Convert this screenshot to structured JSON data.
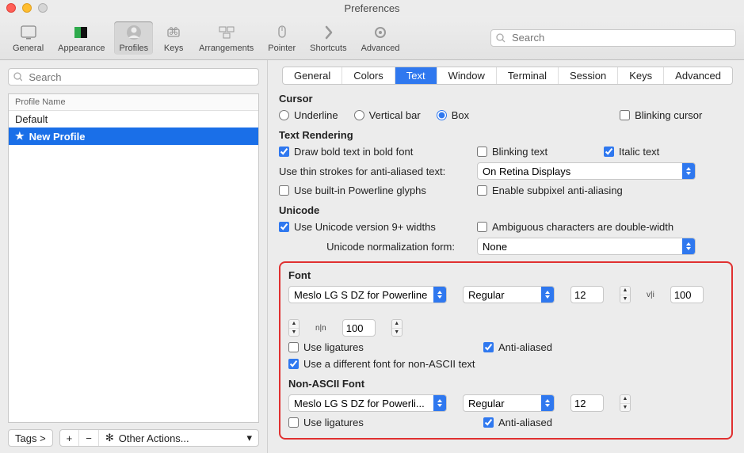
{
  "title": "Preferences",
  "toolbar": {
    "items": [
      "General",
      "Appearance",
      "Profiles",
      "Keys",
      "Arrangements",
      "Pointer",
      "Shortcuts",
      "Advanced"
    ],
    "selected": 2,
    "searchPlaceholder": "Search"
  },
  "left": {
    "searchPlaceholder": "Search",
    "header": "Profile Name",
    "profiles": [
      "Default",
      "New Profile"
    ],
    "selected": 1,
    "tagsLabel": "Tags >",
    "plus": "+",
    "minus": "−",
    "otherActions": "Other Actions..."
  },
  "tabs": {
    "items": [
      "General",
      "Colors",
      "Text",
      "Window",
      "Terminal",
      "Session",
      "Keys",
      "Advanced"
    ],
    "selected": 2
  },
  "cursor": {
    "heading": "Cursor",
    "underline": "Underline",
    "vertical": "Vertical bar",
    "box": "Box",
    "blinking": "Blinking cursor"
  },
  "textRendering": {
    "heading": "Text Rendering",
    "bold": "Draw bold text in bold font",
    "blink": "Blinking text",
    "italic": "Italic text",
    "thinLabel": "Use thin strokes for anti-aliased text:",
    "thinValue": "On Retina Displays",
    "powerline": "Use built-in Powerline glyphs",
    "subpixel": "Enable subpixel anti-aliasing"
  },
  "unicode": {
    "heading": "Unicode",
    "v9": "Use Unicode version 9+ widths",
    "ambig": "Ambiguous characters are double-width",
    "normLabel": "Unicode normalization form:",
    "normValue": "None"
  },
  "font": {
    "heading": "Font",
    "family": "Meslo LG S DZ for Powerline",
    "style": "Regular",
    "size": "12",
    "vhLabel": "v|i",
    "vh": "100",
    "hhLabel": "n|n",
    "hh": "100",
    "ligatures": "Use ligatures",
    "aa": "Anti-aliased",
    "nonascii": "Use a different font for non-ASCII text"
  },
  "nafont": {
    "heading": "Non-ASCII Font",
    "family": "Meslo LG S DZ for Powerli...",
    "style": "Regular",
    "size": "12",
    "ligatures": "Use ligatures",
    "aa": "Anti-aliased"
  }
}
